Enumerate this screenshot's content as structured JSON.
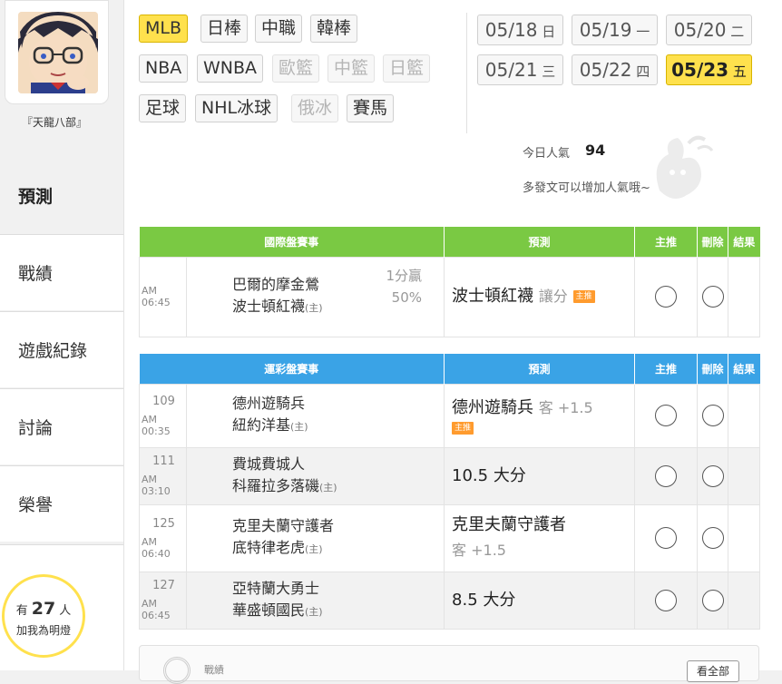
{
  "user": {
    "name": "『天龍八部』"
  },
  "nav": [
    {
      "label": "預測",
      "active": true
    },
    {
      "label": "戰績"
    },
    {
      "label": "遊戲紀錄"
    },
    {
      "label": "討論"
    },
    {
      "label": "榮譽"
    }
  ],
  "fans": {
    "prefix": "有",
    "count": "27",
    "suffix": "人",
    "cta": "加我為明燈"
  },
  "sports": [
    {
      "label": "MLB",
      "state": "active"
    },
    {
      "label": "日棒"
    },
    {
      "label": "中職"
    },
    {
      "label": "韓棒"
    },
    {
      "label": "NBA"
    },
    {
      "label": "WNBA"
    },
    {
      "label": "歐籃",
      "state": "disabled"
    },
    {
      "label": "中籃",
      "state": "disabled"
    },
    {
      "label": "日籃",
      "state": "disabled"
    },
    {
      "label": "足球"
    },
    {
      "label": "NHL冰球"
    },
    {
      "label": "俄冰",
      "state": "disabled"
    },
    {
      "label": "賽馬"
    }
  ],
  "dates": [
    {
      "md": "05/18",
      "day": "日"
    },
    {
      "md": "05/19",
      "day": "一"
    },
    {
      "md": "05/20",
      "day": "二"
    },
    {
      "md": "05/21",
      "day": "三"
    },
    {
      "md": "05/22",
      "day": "四"
    },
    {
      "md": "05/23",
      "day": "五",
      "active": true
    }
  ],
  "popularity": {
    "label": "今日人氣",
    "value": "94",
    "hint": "多發文可以增加人氣哦~"
  },
  "intl_table": {
    "headers": [
      "國際盤賽事",
      "預測",
      "主推",
      "刪除",
      "結果"
    ],
    "rows": [
      {
        "time": "AM 06:45",
        "away": "巴爾的摩金鶯",
        "home": "波士頓紅襪",
        "home_mark": "(主)",
        "line": "1分贏",
        "line2": "50%",
        "pick": "波士頓紅襪",
        "pick_sub": "讓分",
        "tag": "主推"
      }
    ]
  },
  "sports_lottery_table": {
    "headers": [
      "運彩盤賽事",
      "預測",
      "主推",
      "刪除",
      "結果"
    ],
    "rows": [
      {
        "num": "109",
        "time": "AM 00:35",
        "away": "德州遊騎兵",
        "home": "紐約洋基",
        "home_mark": "(主)",
        "pick": "德州遊騎兵",
        "pick_sub": "客 +1.5",
        "tag": "主推"
      },
      {
        "num": "111",
        "time": "AM 03:10",
        "away": "費城費城人",
        "home": "科羅拉多落磯",
        "home_mark": "(主)",
        "pick": "10.5 大分",
        "pick_sub": ""
      },
      {
        "num": "125",
        "time": "AM 06:40",
        "away": "克里夫蘭守護者",
        "home": "底特律老虎",
        "home_mark": "(主)",
        "pick": "克里夫蘭守護者",
        "pick_sub": "客 +1.5"
      },
      {
        "num": "127",
        "time": "AM 06:45",
        "away": "亞特蘭大勇士",
        "home": "華盛頓國民",
        "home_mark": "(主)",
        "pick": "8.5 大分",
        "pick_sub": ""
      }
    ]
  },
  "bottom": {
    "label": "戰績",
    "button": "看全部"
  }
}
